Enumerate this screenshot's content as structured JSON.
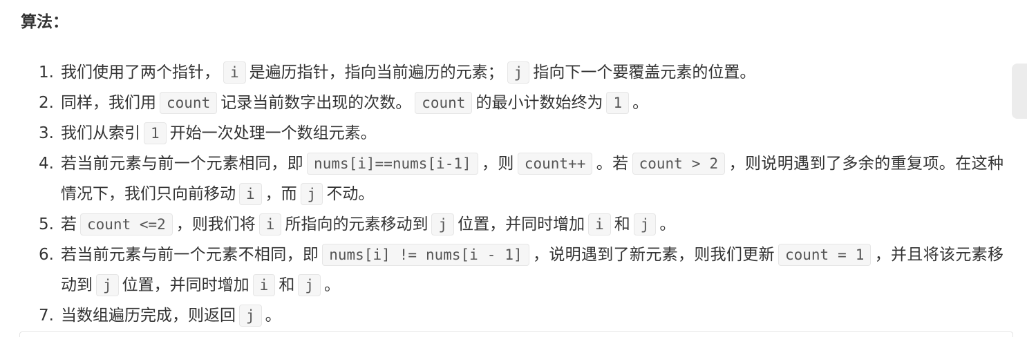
{
  "heading": "算法：",
  "steps": [
    {
      "num": "1.",
      "t1": "我们使用了两个指针，",
      "c1": "i",
      "t2": "是遍历指针，指向当前遍历的元素；",
      "c2": "j",
      "t3": "指向下一个要覆盖元素的位置。"
    },
    {
      "num": "2.",
      "t1": "同样，我们用",
      "c1": "count",
      "t2": "记录当前数字出现的次数。",
      "c2": "count",
      "t3": "的最小计数始终为",
      "c3": "1",
      "t4": "。"
    },
    {
      "num": "3.",
      "t1": "我们从索引",
      "c1": "1",
      "t2": "开始一次处理一个数组元素。"
    },
    {
      "num": "4.",
      "t1": "若当前元素与前一个元素相同，即",
      "c1": "nums[i]==nums[i-1]",
      "t2": "，则",
      "c2": "count++",
      "t3": "。若",
      "c3": "count > 2",
      "t4": "，则说明遇到了多余的重复项。在这种情况下，我们只向前移动",
      "c4": "i",
      "t5": "，而",
      "c5": "j",
      "t6": "不动。"
    },
    {
      "num": "5.",
      "t1": "若",
      "c1": "count <=2",
      "t2": "，则我们将",
      "c2": "i",
      "t3": "所指向的元素移动到",
      "c3": "j",
      "t4": "位置，并同时增加",
      "c4": "i",
      "t5": "和",
      "c5": "j",
      "t6": "。"
    },
    {
      "num": "6.",
      "t1": "若当前元素与前一个元素不相同，即",
      "c1": "nums[i] != nums[i - 1]",
      "t2": "，说明遇到了新元素，则我们更新",
      "c2": "count = 1",
      "t3": "，并且将该元素移动到",
      "c3": "j",
      "t4": "位置，并同时增加",
      "c4": "i",
      "t5": "和",
      "c5": "j",
      "t6": "。"
    },
    {
      "num": "7.",
      "t1": "当数组遍历完成，则返回",
      "c1": "j",
      "t2": "。"
    }
  ]
}
